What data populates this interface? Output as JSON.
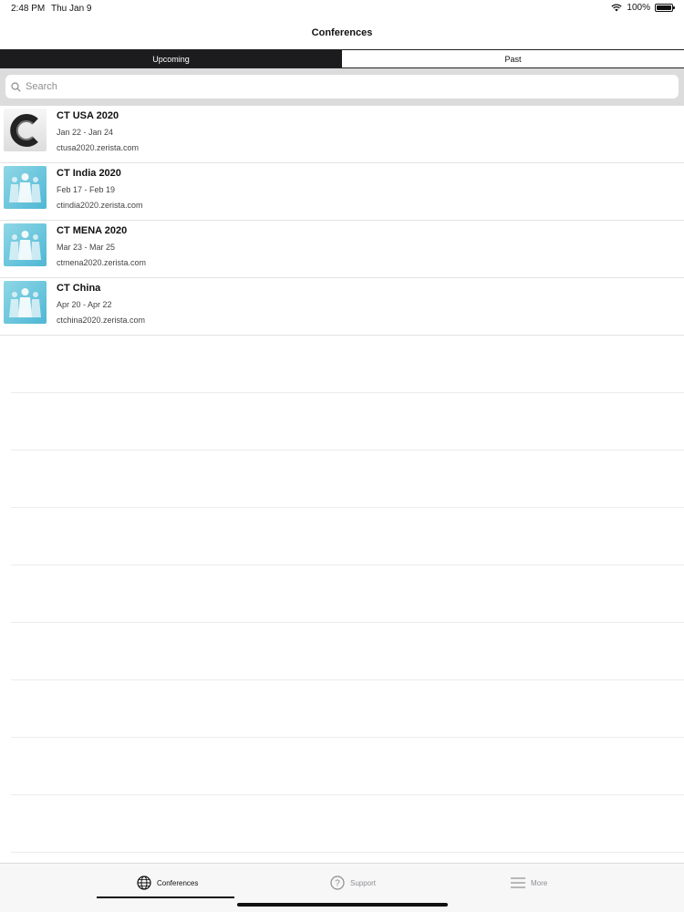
{
  "status": {
    "time": "2:48 PM",
    "date": "Thu Jan 9",
    "battery": "100%"
  },
  "nav": {
    "title": "Conferences"
  },
  "segments": {
    "upcoming": "Upcoming",
    "past": "Past"
  },
  "search": {
    "placeholder": "Search",
    "value": ""
  },
  "conferences": [
    {
      "title": "CT USA 2020",
      "dates": "Jan 22 - Jan 24",
      "url": "ctusa2020.zerista.com",
      "icon": "c-logo-icon"
    },
    {
      "title": "CT India 2020",
      "dates": "Feb 17 - Feb 19",
      "url": "ctindia2020.zerista.com",
      "icon": "people-group-icon"
    },
    {
      "title": "CT MENA 2020",
      "dates": "Mar 23 - Mar 25",
      "url": "ctmena2020.zerista.com",
      "icon": "people-group-icon"
    },
    {
      "title": "CT China",
      "dates": "Apr 20 - Apr 22",
      "url": "ctchina2020.zerista.com",
      "icon": "people-group-icon"
    }
  ],
  "tabs": {
    "conferences": "Conferences",
    "support": "Support",
    "more": "More"
  },
  "colors": {
    "accent": "#1c1c1e",
    "thumb_blue": "#4fb7d4",
    "muted": "#8e8e93"
  }
}
